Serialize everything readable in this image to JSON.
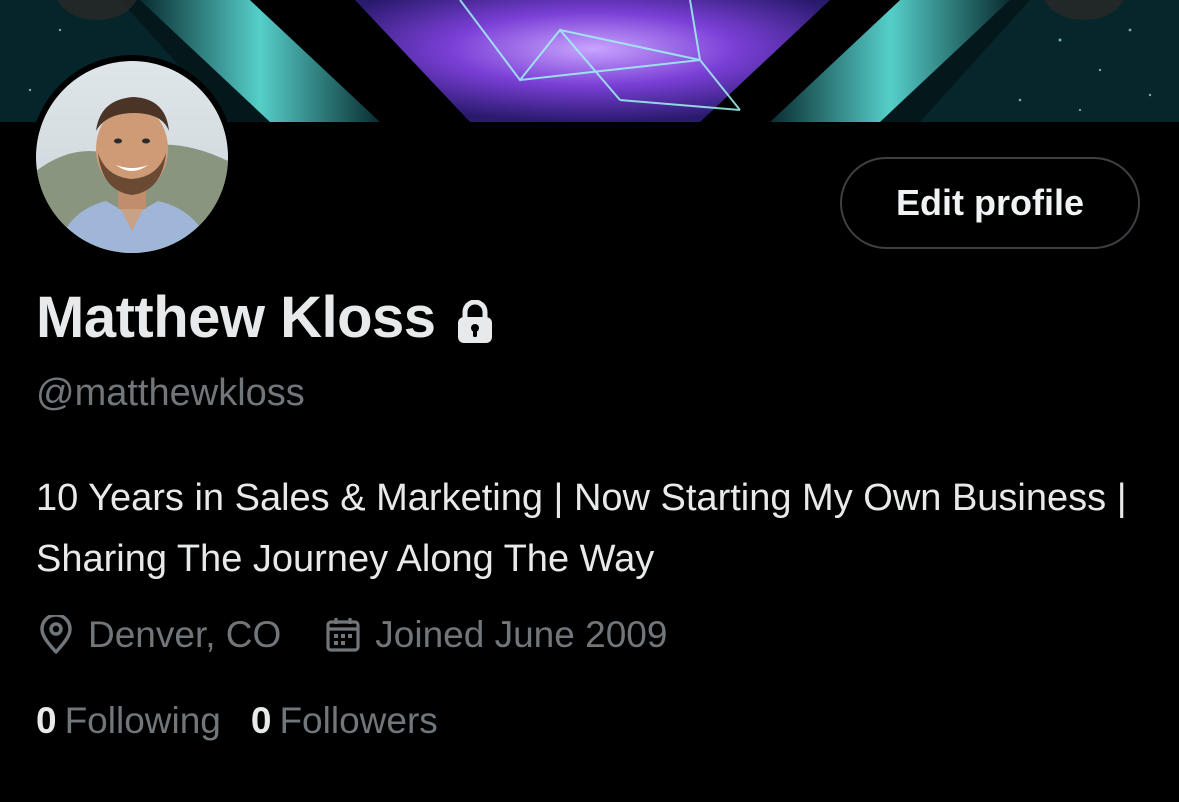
{
  "profile": {
    "display_name": "Matthew Kloss",
    "handle": "@matthewkloss",
    "bio": "10 Years in Sales & Marketing | Now Starting My Own Business | Sharing The Journey Along The Way",
    "location": "Denver, CO",
    "joined": "Joined June 2009",
    "protected": true
  },
  "actions": {
    "edit_profile_label": "Edit profile"
  },
  "stats": {
    "following_count": "0",
    "following_label": "Following",
    "followers_count": "0",
    "followers_label": "Followers"
  },
  "icons": {
    "lock": "lock-icon",
    "location": "location-pin-icon",
    "calendar": "calendar-icon"
  },
  "colors": {
    "background": "#000000",
    "primary_text": "#e7e9ea",
    "secondary_text": "#71767b",
    "button_border": "#3e4144",
    "banner_accent": "#7ff0e8"
  }
}
